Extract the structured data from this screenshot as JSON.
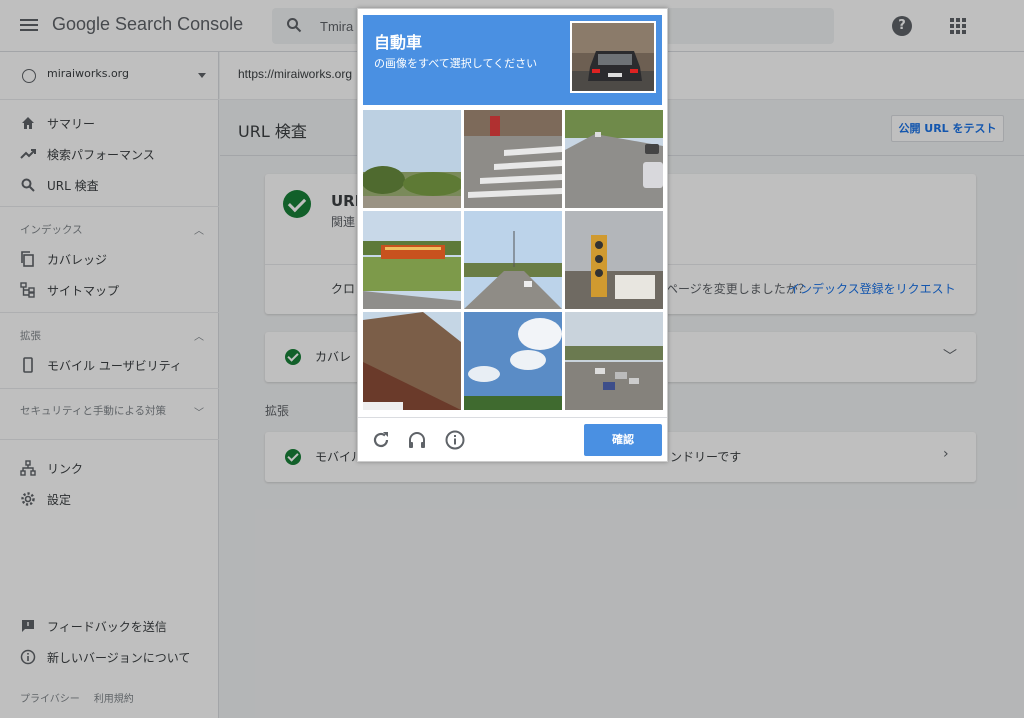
{
  "app": {
    "title": "Google Search Console"
  },
  "search": {
    "value": "Tmira"
  },
  "header": {
    "help_glyph": "?"
  },
  "property": {
    "name": "miraiworks.org"
  },
  "nav": {
    "summary": "サマリー",
    "performance": "検索パフォーマンス",
    "url_inspection": "URL 検査",
    "index_section": "インデックス",
    "coverage": "カバレッジ",
    "sitemaps": "サイトマップ",
    "enhancements_section": "拡張",
    "mobile_usability": "モバイル ユーザビリティ",
    "security_section": "セキュリティと手動による対策",
    "links": "リンク",
    "settings": "設定",
    "feedback": "フィードバックを送信",
    "new_version": "新しいバージョンについて",
    "privacy": "プライバシー",
    "terms": "利用規約"
  },
  "main": {
    "url": "https://miraiworks.org",
    "page_title": "URL 検査",
    "test_live_button": "公開 URL をテスト",
    "status_title": "URL",
    "status_desc": "関連 されます（手動によ る対",
    "action_crawl": "クロ",
    "action_changed": "ページを変更しましたか？",
    "action_request_index": "インデックス登録をリクエスト",
    "coverage_label": "カバレ",
    "enhancements_label": "拡張",
    "mobile_label": "モバイル",
    "mobile_status": "ンドリーです"
  },
  "captcha": {
    "target_word": "自動車",
    "instruction": "の画像をすべて選択してください",
    "verify_button": "確認",
    "tiles": [
      "tile-1",
      "tile-2",
      "tile-3",
      "tile-4",
      "tile-5",
      "tile-6",
      "tile-7",
      "tile-8",
      "tile-9"
    ]
  },
  "icons": {
    "reload": "reload-icon",
    "audio": "headphones-icon",
    "info": "info-icon"
  },
  "colors": {
    "captcha_blue": "#4a90e2",
    "success_green": "#188038",
    "overlay": "rgba(0,0,0,0.25)"
  }
}
